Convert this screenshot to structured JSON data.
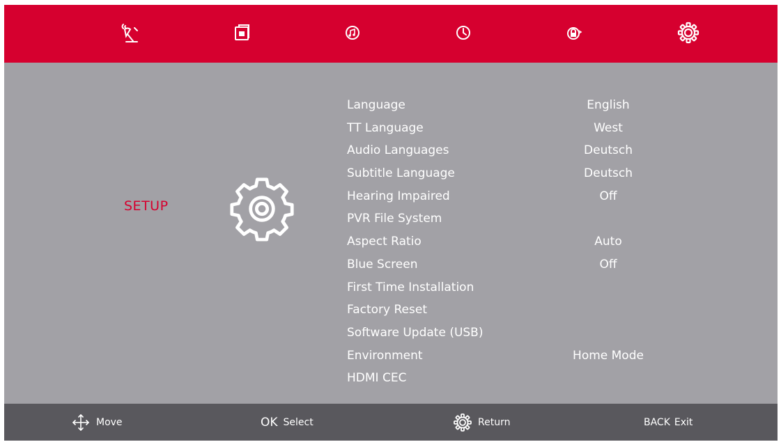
{
  "colors": {
    "accent": "#d6002f",
    "background": "#a2a1a6",
    "footer": "#59585d",
    "text": "#ffffff"
  },
  "tabs": [
    {
      "icon": "satellite-icon"
    },
    {
      "icon": "picture-icon"
    },
    {
      "icon": "sound-icon"
    },
    {
      "icon": "clock-icon"
    },
    {
      "icon": "lock-icon"
    },
    {
      "icon": "gear-icon",
      "active": true
    }
  ],
  "section": {
    "title": "SETUP",
    "icon": "gear-icon"
  },
  "menu": [
    {
      "label": "Language",
      "value": "English"
    },
    {
      "label": "TT Language",
      "value": "West"
    },
    {
      "label": "Audio Languages",
      "value": "Deutsch"
    },
    {
      "label": "Subtitle Language",
      "value": "Deutsch"
    },
    {
      "label": "Hearing Impaired",
      "value": "Off"
    },
    {
      "label": "PVR File System",
      "value": ""
    },
    {
      "label": "Aspect Ratio",
      "value": "Auto"
    },
    {
      "label": "Blue Screen",
      "value": "Off"
    },
    {
      "label": "First Time Installation",
      "value": ""
    },
    {
      "label": "Factory Reset",
      "value": ""
    },
    {
      "label": "Software Update (USB)",
      "value": ""
    },
    {
      "label": "Environment",
      "value": "Home Mode"
    },
    {
      "label": "HDMI CEC",
      "value": ""
    }
  ],
  "footer": {
    "move_label": "Move",
    "ok_key": "OK",
    "select_label": "Select",
    "return_label": "Return",
    "back_key": "BACK",
    "exit_label": "Exit"
  }
}
